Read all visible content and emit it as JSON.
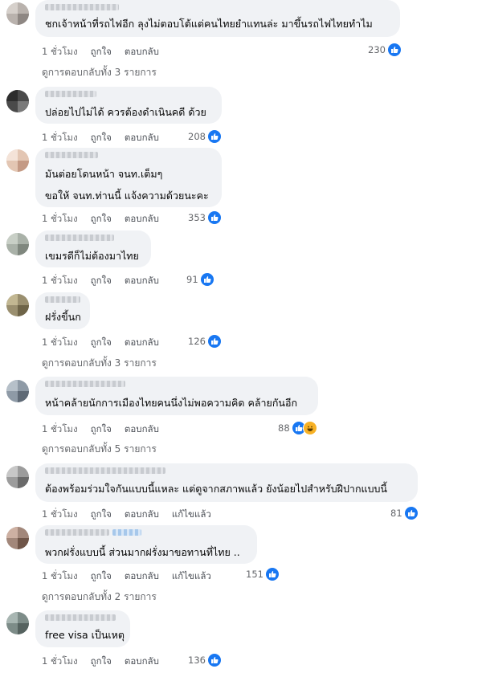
{
  "labels": {
    "like": "ถูกใจ",
    "reply": "ตอบกลับ",
    "edited": "แก้ไขแล้ว"
  },
  "comments": [
    {
      "text": [
        "ชกเจ้าหน้าที่รถไฟอีก ลุงไม่ตอบโต้แต่คนไทยยำแทนล่ะ มาขึ้นรถไฟไทยทำไม"
      ],
      "time": "1 ชั่วโมง",
      "reactions": "230",
      "replies": "ดูการตอบกลับทั้ง 3 รายการ"
    },
    {
      "text": [
        "ปล่อยไปไม่ได้ ควรต้องดำเนินคดี ด้วย"
      ],
      "time": "1 ชั่วโมง",
      "reactions": "208"
    },
    {
      "text": [
        "มันต่อยโดนหน้า จนท.เต็มๆ",
        "ขอให้ จนท.ท่านนี้ แจ้งความด้วยนะคะ"
      ],
      "time": "1 ชั่วโมง",
      "reactions": "353"
    },
    {
      "text": [
        "เขมรดีก็ไม่ต้องมาไทย"
      ],
      "time": "1 ชั่วโมง",
      "reactions": "91"
    },
    {
      "text": [
        "ฝรั่งขี้นก"
      ],
      "time": "1 ชั่วโมง",
      "reactions": "126",
      "replies": "ดูการตอบกลับทั้ง 3 รายการ"
    },
    {
      "text": [
        "หน้าคล้ายนักการเมืองไทยคนนึ่งไม่พอความคิด คล้ายกันอีก"
      ],
      "time": "1 ชั่วโมง",
      "reactions": "88",
      "replies": "ดูการตอบกลับทั้ง 5 รายการ"
    },
    {
      "text": [
        "ต้องพร้อมร่วมใจกันแบบนี้แหละ แต่ดูจากสภาพแล้ว ยังน้อยไปสำหรับฝีปากแบบนี้"
      ],
      "time": "1 ชั่วโมง",
      "reactions": "81",
      "edited": true
    },
    {
      "text": [
        "พวกฝรั่งแบบนี้ ส่วนมากฝรั่งมาขอทานที่ไทย .."
      ],
      "time": "1 ชั่วโมง",
      "reactions": "151",
      "edited": true,
      "replies": "ดูการตอบกลับทั้ง 2 รายการ"
    },
    {
      "text": [
        "free visa เป็นเหตุ"
      ],
      "time": "1 ชั่วโมง",
      "reactions": "136"
    }
  ]
}
